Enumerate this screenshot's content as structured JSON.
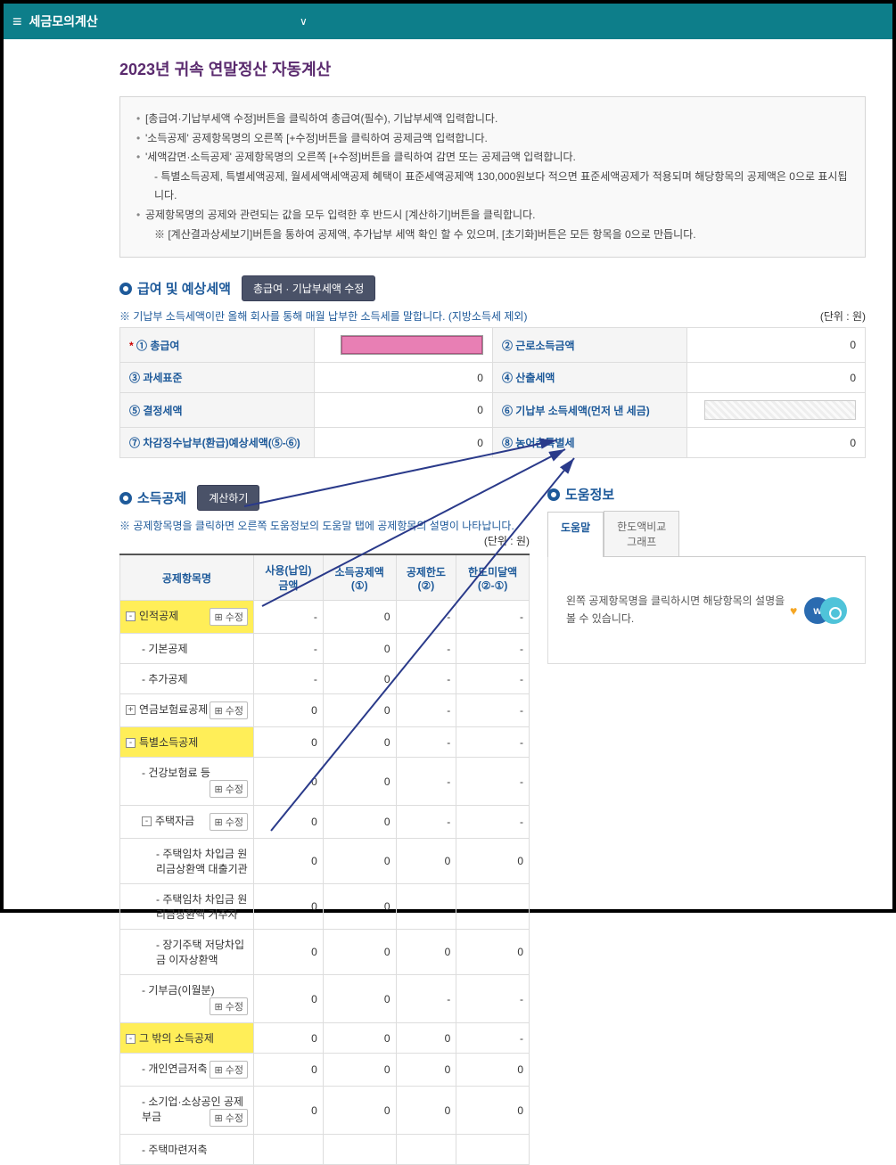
{
  "topbar": {
    "title": "세금모의계산"
  },
  "page_title": "2023년 귀속 연말정산 자동계산",
  "info": [
    "[총급여·기납부세액 수정]버튼을 클릭하여 총급여(필수), 기납부세액 입력합니다.",
    "'소득공제' 공제항목명의 오른쪽 [+수정]버튼을 클릭하여 공제금액 입력합니다.",
    "'세액감면·소득공제' 공제항목명의 오른쪽 [+수정]버튼을 클릭하여 감면 또는 공제금액 입력합니다.",
    "- 특별소득공제, 특별세액공제, 월세세액세액공제 혜택이 표준세액공제액 130,000원보다 적으면 표준세액공제가 적용되며 해당항목의 공제액은 0으로 표시됩니다.",
    "공제항목명의 공제와 관련되는 값을 모두 입력한 후 반드시 [계산하기]버튼을 클릭합니다.",
    "※ [계산결과상세보기]버튼을 통하여 공제액, 추가납부 세액 확인 할 수 있으며, [초기화]버튼은 모든 항목을 0으로 만듭니다."
  ],
  "salary_section": {
    "title": "급여 및 예상세액",
    "button": "총급여 · 기납부세액 수정",
    "note": "※ 기납부 소득세액이란 올해 회사를 통해 매월 납부한 소득세를 말합니다. (지방소득세 제외)",
    "unit": "(단위 : 원)",
    "rows": [
      {
        "l1": "① 총급여",
        "v1_field": true,
        "l2": "② 근로소득금액",
        "v2": "0"
      },
      {
        "l1": "③ 과세표준",
        "v1": "0",
        "l2": "④ 산출세액",
        "v2": "0"
      },
      {
        "l1": "⑤ 결정세액",
        "v1": "0",
        "l2": "⑥ 기납부 소득세액(먼저 낸 세금)",
        "v2_hatched": true
      },
      {
        "l1": "⑦ 차감징수납부(환급)예상세액(⑤-⑥)",
        "v1": "0",
        "l2": "⑧ 농어촌특별세",
        "v2": "0"
      }
    ]
  },
  "deduct_section": {
    "title": "소득공제",
    "button": "계산하기",
    "note": "※ 공제항목명을 클릭하면 오른쪽 도움정보의 도움말 탭에 공제항목의 설명이 나타납니다.",
    "unit": "(단위 : 원)",
    "headers": [
      "공제항목명",
      "사용(납입)\n금액",
      "소득공제액\n(①)",
      "공제한도\n(②)",
      "한도미달액\n(②-①)"
    ],
    "rows": [
      {
        "name": "인적공제",
        "col": "-",
        "ic": "0",
        "lim": "-",
        "sh": "-",
        "hl": true,
        "mod": true,
        "indent": 0,
        "collapse": "-"
      },
      {
        "name": "- 기본공제",
        "col": "-",
        "ic": "0",
        "lim": "-",
        "sh": "-",
        "indent": 1
      },
      {
        "name": "- 추가공제",
        "col": "-",
        "ic": "0",
        "lim": "-",
        "sh": "-",
        "indent": 1
      },
      {
        "name": "연금보험료공제",
        "col": "0",
        "ic": "0",
        "lim": "-",
        "sh": "-",
        "mod": true,
        "indent": 0,
        "collapse": "+"
      },
      {
        "name": "특별소득공제",
        "col": "0",
        "ic": "0",
        "lim": "-",
        "sh": "-",
        "hl": true,
        "indent": 0,
        "collapse": "-"
      },
      {
        "name": "- 건강보험료 등",
        "col": "0",
        "ic": "0",
        "lim": "-",
        "sh": "-",
        "mod": true,
        "indent": 1
      },
      {
        "name": "주택자금",
        "col": "0",
        "ic": "0",
        "lim": "-",
        "sh": "-",
        "mod": true,
        "indent": 1,
        "collapse": "-"
      },
      {
        "name": "- 주택임차 차입금 원리금상환액 대출기관",
        "col": "0",
        "ic": "0",
        "lim": "0",
        "sh": "0",
        "indent": 2
      },
      {
        "name": "- 주택임차 차입금 원리금상환액 거주자",
        "col": "0",
        "ic": "0",
        "lim": "",
        "sh": "",
        "indent": 2
      },
      {
        "name": "- 장기주택 저당차입금 이자상환액",
        "col": "0",
        "ic": "0",
        "lim": "0",
        "sh": "0",
        "indent": 2
      },
      {
        "name": "- 기부금(이월분)",
        "col": "0",
        "ic": "0",
        "lim": "-",
        "sh": "-",
        "mod": true,
        "indent": 1
      },
      {
        "name": "그 밖의 소득공제",
        "col": "0",
        "ic": "0",
        "lim": "0",
        "sh": "-",
        "hl": true,
        "indent": 0,
        "collapse": "-"
      },
      {
        "name": "- 개인연금저축",
        "col": "0",
        "ic": "0",
        "lim": "0",
        "sh": "0",
        "mod": true,
        "indent": 1
      },
      {
        "name": "- 소기업·소상공인 공제부금",
        "col": "0",
        "ic": "0",
        "lim": "0",
        "sh": "0",
        "mod": true,
        "indent": 1
      },
      {
        "name": "- 주택마련저축",
        "col": "",
        "ic": "",
        "lim": "",
        "sh": "",
        "indent": 1
      }
    ],
    "mod_label": "수정"
  },
  "help_section": {
    "title": "도움정보",
    "tabs": [
      "도움말",
      "한도액비교\n그래프"
    ],
    "body": "왼쪽 공제항목명을 클릭하시면 해당항목의 설명을 볼 수 있습니다."
  }
}
